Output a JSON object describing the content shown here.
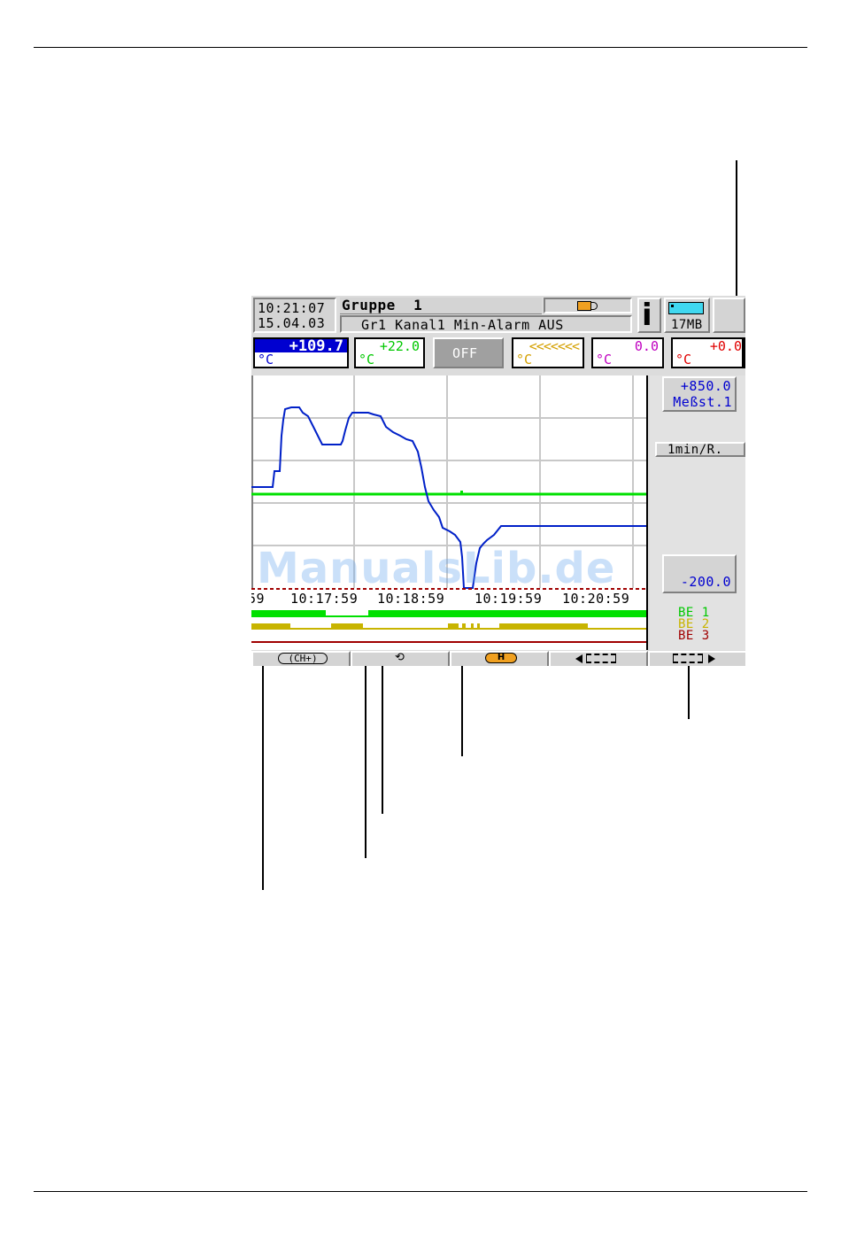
{
  "header": {
    "time": "10:21:07",
    "date": "15.04.03",
    "group_title": "Gruppe  1",
    "status_message": "Gr1 Kanal1 Min-Alarm AUS",
    "memory_label": "17MB"
  },
  "channels": [
    {
      "value": "+109.7",
      "unit": "°C",
      "color": "#0000ff",
      "active": true
    },
    {
      "value": "+22.0",
      "unit": "°C",
      "color": "#00c800"
    },
    {
      "value": "OFF",
      "unit": "",
      "color": "#ffffff",
      "off": true
    },
    {
      "value": "<<<<<<<",
      "unit": "°C",
      "color": "#d4a000"
    },
    {
      "value": "0.0",
      "unit": "°C",
      "color": "#c000c0"
    },
    {
      "value": "+0.0",
      "unit": "°C",
      "color": "#e00000"
    }
  ],
  "scale": {
    "max_value": "+850.0",
    "max_label": "Meßst.1",
    "speed": "1min/R.",
    "min_value": "-200.0"
  },
  "time_axis": [
    "59",
    "10:17:59",
    "10:18:59",
    "10:19:59",
    "10:20:59"
  ],
  "binary_inputs": [
    {
      "label": "BE 1",
      "color": "#00c800"
    },
    {
      "label": "BE 2",
      "color": "#c8b400"
    },
    {
      "label": "BE 3",
      "color": "#a00000"
    }
  ],
  "function_keys": [
    {
      "label": "CH+",
      "icon": "ch-plus-icon"
    },
    {
      "label": "",
      "icon": "rotate-icon"
    },
    {
      "label": "H",
      "icon": "history-icon"
    },
    {
      "label": "",
      "icon": "scroll-left-icon"
    },
    {
      "label": "",
      "icon": "scroll-right-icon"
    }
  ],
  "watermark": "ManualsLib.de"
}
